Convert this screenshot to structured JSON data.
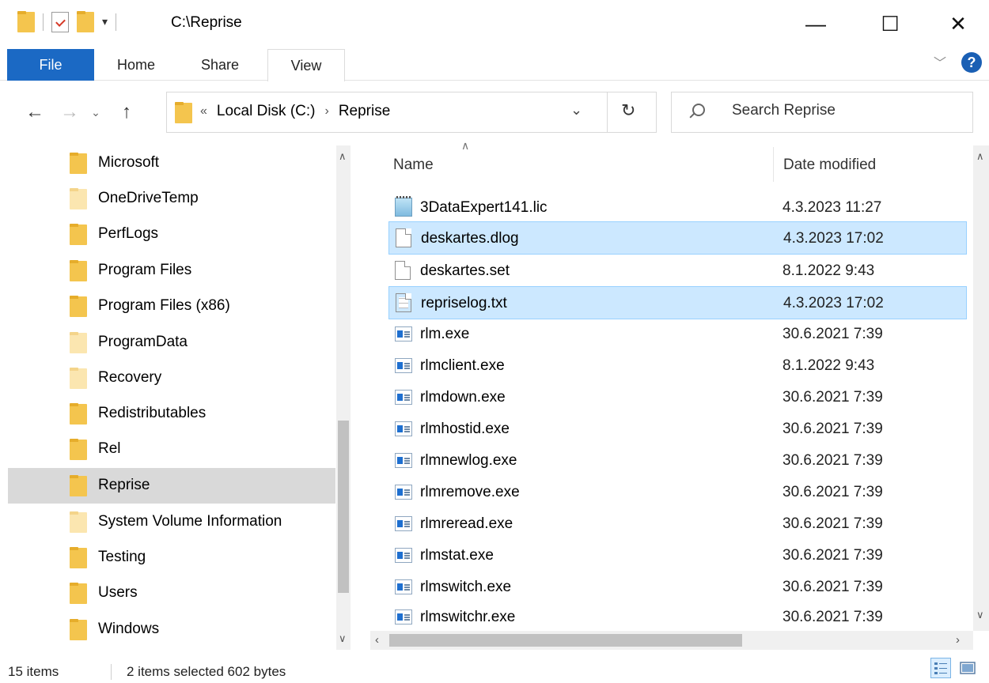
{
  "window": {
    "title": "C:\\Reprise",
    "minimize": "—",
    "maximize": "☐",
    "close": "✕"
  },
  "ribbon": {
    "tabs": [
      {
        "label": "File"
      },
      {
        "label": "Home"
      },
      {
        "label": "Share"
      },
      {
        "label": "View"
      }
    ],
    "help_label": "?"
  },
  "address": {
    "overflow": "«",
    "crumbs": [
      "Local Disk (C:)",
      "Reprise"
    ],
    "separator": "›"
  },
  "search": {
    "placeholder": "Search Reprise"
  },
  "nav": {
    "items": [
      {
        "label": "Microsoft"
      },
      {
        "label": "OneDriveTemp"
      },
      {
        "label": "PerfLogs"
      },
      {
        "label": "Program Files"
      },
      {
        "label": "Program Files (x86)"
      },
      {
        "label": "ProgramData"
      },
      {
        "label": "Recovery"
      },
      {
        "label": "Redistributables"
      },
      {
        "label": "Rel"
      },
      {
        "label": "Reprise"
      },
      {
        "label": "System Volume Information"
      },
      {
        "label": "Testing"
      },
      {
        "label": "Users"
      },
      {
        "label": "Windows"
      }
    ]
  },
  "files": {
    "columns": {
      "name": "Name",
      "date": "Date modified"
    },
    "rows": [
      {
        "name": "3DataExpert141.lic",
        "date": "4.3.2023 11:27"
      },
      {
        "name": "deskartes.dlog",
        "date": "4.3.2023 17:02"
      },
      {
        "name": "deskartes.set",
        "date": "8.1.2022 9:43"
      },
      {
        "name": "repriselog.txt",
        "date": "4.3.2023 17:02"
      },
      {
        "name": "rlm.exe",
        "date": "30.6.2021 7:39"
      },
      {
        "name": "rlmclient.exe",
        "date": "8.1.2022 9:43"
      },
      {
        "name": "rlmdown.exe",
        "date": "30.6.2021 7:39"
      },
      {
        "name": "rlmhostid.exe",
        "date": "30.6.2021 7:39"
      },
      {
        "name": "rlmnewlog.exe",
        "date": "30.6.2021 7:39"
      },
      {
        "name": "rlmremove.exe",
        "date": "30.6.2021 7:39"
      },
      {
        "name": "rlmreread.exe",
        "date": "30.6.2021 7:39"
      },
      {
        "name": "rlmstat.exe",
        "date": "30.6.2021 7:39"
      },
      {
        "name": "rlmswitch.exe",
        "date": "30.6.2021 7:39"
      },
      {
        "name": "rlmswitchr.exe",
        "date": "30.6.2021 7:39"
      }
    ]
  },
  "status": {
    "count": "15 items",
    "selection": "2 items selected  602 bytes"
  }
}
